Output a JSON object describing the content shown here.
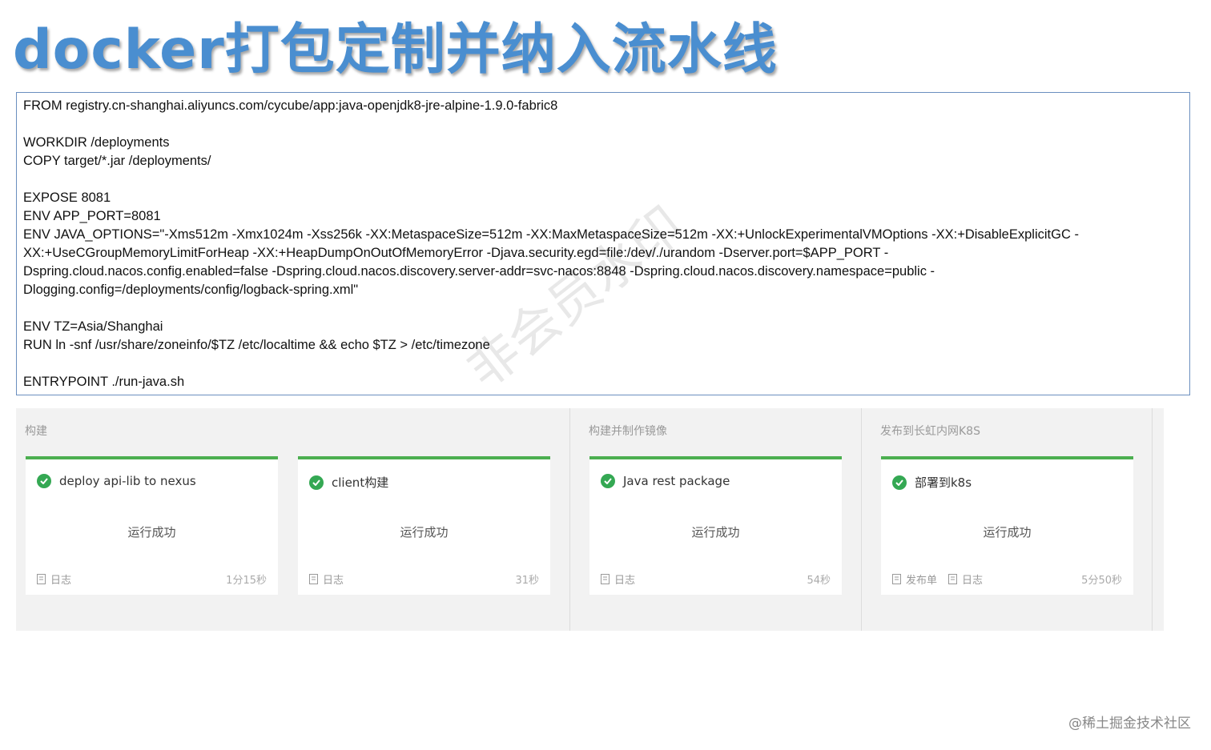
{
  "title": "docker打包定制并纳入流水线",
  "code_lines": [
    "FROM registry.cn-shanghai.aliyuncs.com/cycube/app:java-openjdk8-jre-alpine-1.9.0-fabric8",
    "",
    "WORKDIR /deployments",
    "COPY target/*.jar /deployments/",
    "",
    "EXPOSE 8081",
    "ENV APP_PORT=8081",
    "ENV JAVA_OPTIONS=\"-Xms512m -Xmx1024m -Xss256k -XX:MetaspaceSize=512m -XX:MaxMetaspaceSize=512m -XX:+UnlockExperimentalVMOptions -XX:+DisableExplicitGC -",
    "XX:+UseCGroupMemoryLimitForHeap -XX:+HeapDumpOnOutOfMemoryError -Djava.security.egd=file:/dev/./urandom -Dserver.port=$APP_PORT -",
    "Dspring.cloud.nacos.config.enabled=false -Dspring.cloud.nacos.discovery.server-addr=svc-nacos:8848 -Dspring.cloud.nacos.discovery.namespace=public -",
    "Dlogging.config=/deployments/config/logback-spring.xml\"",
    "",
    "ENV TZ=Asia/Shanghai",
    "RUN ln -snf /usr/share/zoneinfo/$TZ /etc/localtime && echo $TZ > /etc/timezone",
    "",
    "ENTRYPOINT ./run-java.sh"
  ],
  "pipeline": {
    "stages": [
      {
        "name": "构建"
      },
      {
        "name": "构建并制作镜像"
      },
      {
        "name": "发布到长虹内网K8S"
      }
    ],
    "jobs": [
      {
        "name": "deploy api-lib to nexus",
        "status": "运行成功",
        "log_label": "日志",
        "duration": "1分15秒"
      },
      {
        "name": "client构建",
        "status": "运行成功",
        "log_label": "日志",
        "duration": "31秒"
      },
      {
        "name": "Java rest package",
        "status": "运行成功",
        "log_label": "日志",
        "duration": "54秒"
      },
      {
        "name": "部署到k8s",
        "status": "运行成功",
        "release_label": "发布单",
        "log_label": "日志",
        "duration": "5分50秒"
      }
    ]
  },
  "watermark": "非会员水印",
  "credit": "@稀土掘金技术社区",
  "colors": {
    "title": "#4a8ed0",
    "success": "#34a853",
    "job_bar": "#4caf50",
    "panel_bg": "#f2f2f2"
  },
  "icons": {
    "job_status": "check-circle-icon",
    "log": "document-icon",
    "release": "document-icon"
  }
}
